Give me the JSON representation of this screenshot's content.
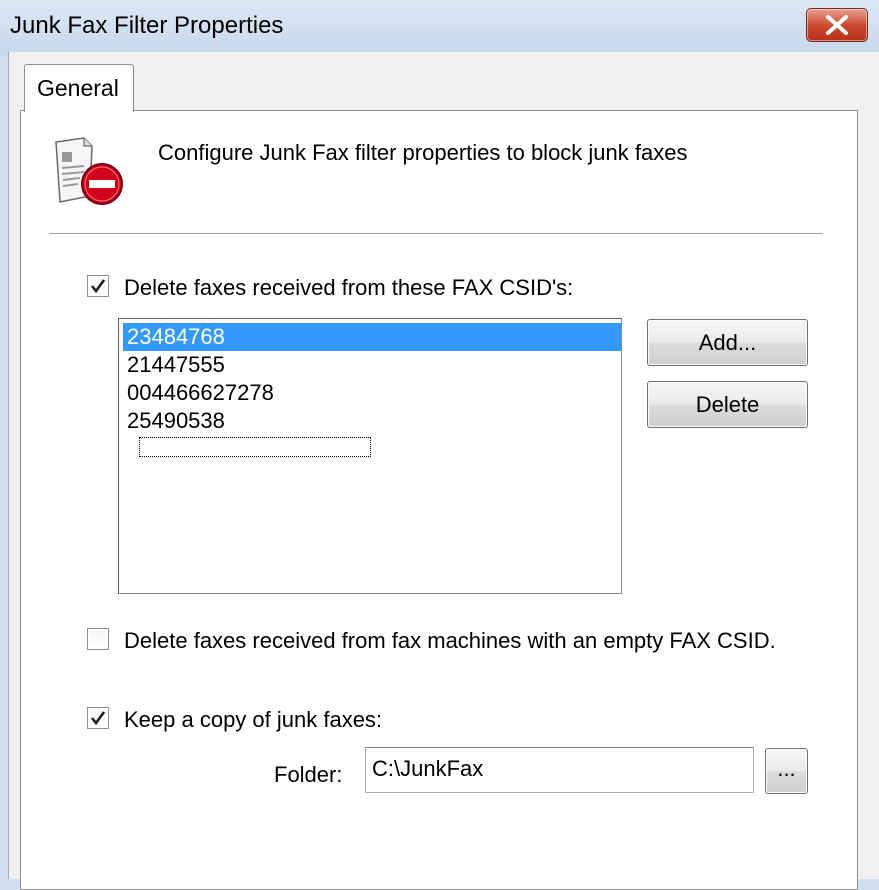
{
  "window": {
    "title": "Junk Fax Filter Properties",
    "close_icon": "close-icon"
  },
  "tabs": [
    {
      "label": "General",
      "selected": true
    }
  ],
  "header": {
    "icon": "fax-blocked-icon",
    "text": "Configure Junk Fax filter properties to block junk faxes"
  },
  "csid_filter": {
    "checked": true,
    "label": "Delete faxes received from these FAX CSID's:",
    "items": [
      "23484768",
      "21447555",
      "004466627278",
      "25490538"
    ],
    "selected_index": 0,
    "add_label": "Add...",
    "delete_label": "Delete"
  },
  "empty_csid": {
    "checked": false,
    "label": "Delete faxes received from fax machines with an empty FAX CSID."
  },
  "keep_copy": {
    "checked": true,
    "label": "Keep a copy of junk faxes:",
    "folder_label": "Folder:",
    "folder_value": "C:\\JunkFax",
    "browse_label": "..."
  },
  "colors": {
    "selection": "#3399ff",
    "close_button": "#c9452b",
    "blocked_badge": "#d0021b"
  }
}
